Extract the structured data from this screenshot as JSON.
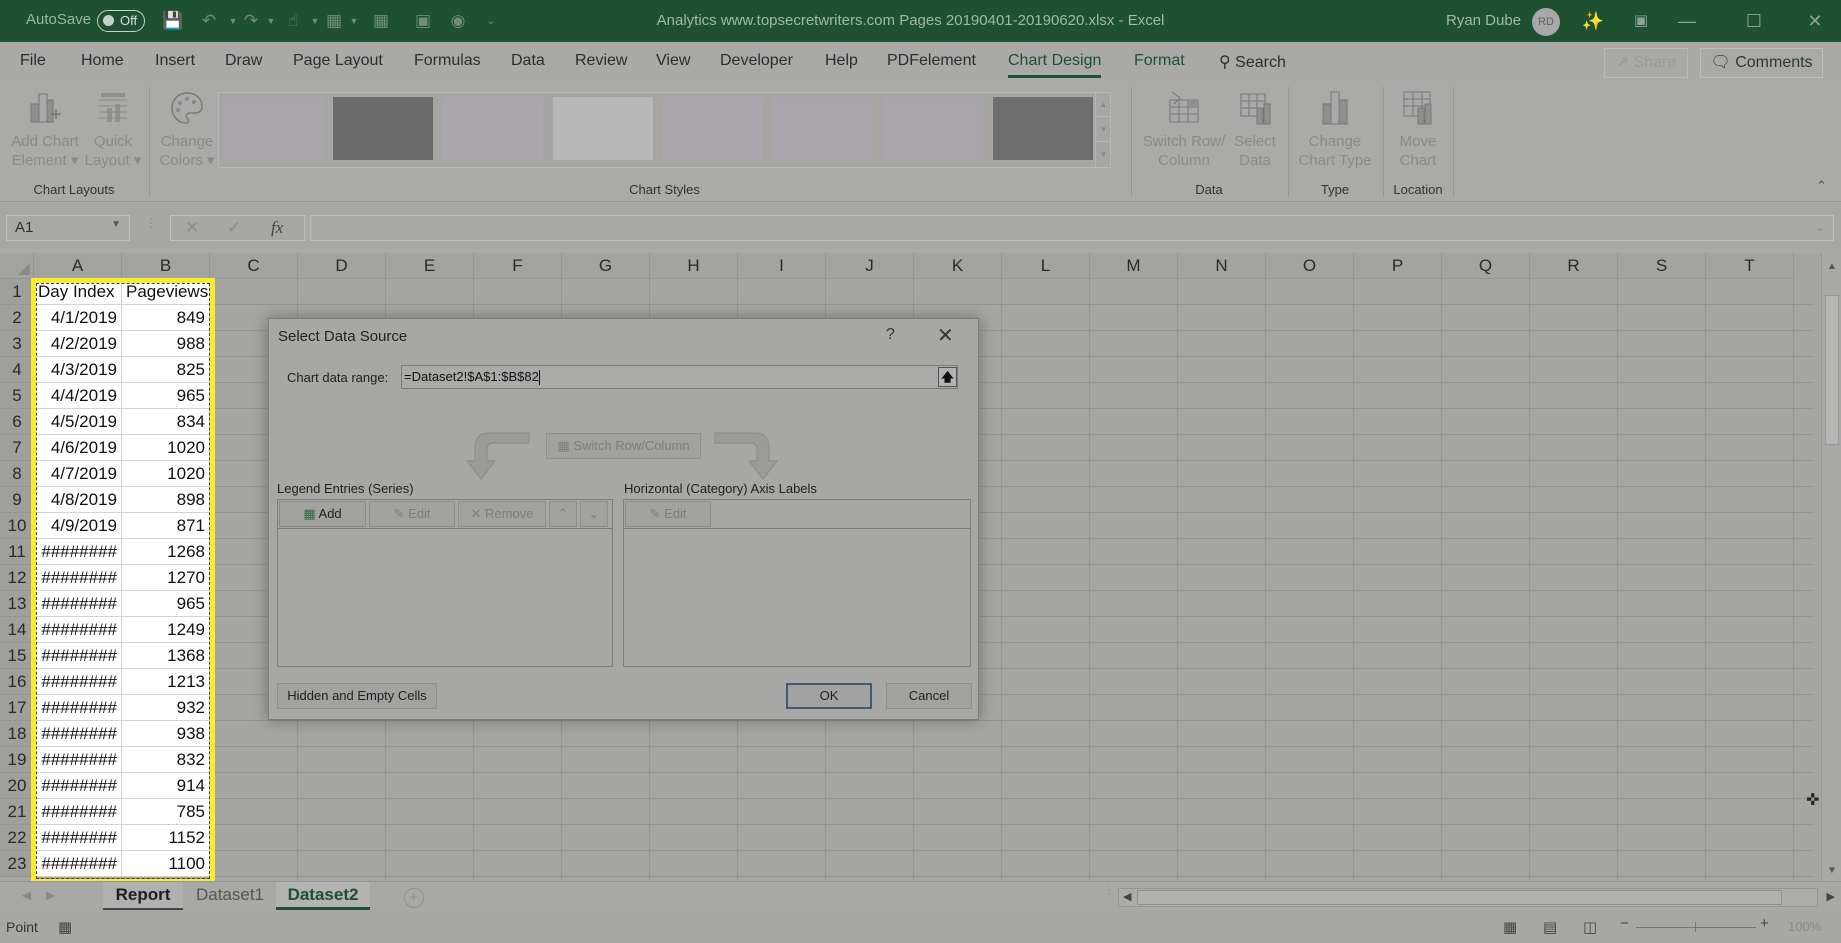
{
  "titlebar": {
    "autosave_label": "AutoSave",
    "autosave_state": "Off",
    "document_title": "Analytics www.topsecretwriters.com Pages 20190401-20190620.xlsx  -  Excel",
    "user_name": "Ryan Dube",
    "user_initials": "RD"
  },
  "ribbon_tabs": [
    "File",
    "Home",
    "Insert",
    "Draw",
    "Page Layout",
    "Formulas",
    "Data",
    "Review",
    "View",
    "Developer",
    "Help",
    "PDFelement",
    "Chart Design",
    "Format"
  ],
  "active_tab": "Chart Design",
  "search_label": "Search",
  "share_label": "Share",
  "comments_label": "Comments",
  "ribbon": {
    "add_chart_element": [
      "Add Chart",
      "Element"
    ],
    "quick_layout": [
      "Quick",
      "Layout"
    ],
    "change_colors": [
      "Change",
      "Colors"
    ],
    "group_chart_layouts": "Chart Layouts",
    "group_chart_styles": "Chart Styles",
    "switch_row_column": [
      "Switch Row/",
      "Column"
    ],
    "select_data": [
      "Select",
      "Data"
    ],
    "group_data": "Data",
    "change_chart_type": [
      "Change",
      "Chart Type"
    ],
    "group_type": "Type",
    "move_chart": [
      "Move",
      "Chart"
    ],
    "group_location": "Location",
    "style_swatch_colors": [
      "#aba6ab",
      "#6b6b6b",
      "#aba7ad",
      "#b8b8b8",
      "#aba7ad",
      "#aaa6ab",
      "#aaa6ab",
      "#6e6e6e"
    ]
  },
  "formula_bar": {
    "name_box": "A1",
    "fx_label": "fx",
    "formula": ""
  },
  "columns": [
    "A",
    "B",
    "C",
    "D",
    "E",
    "F",
    "G",
    "H",
    "I",
    "J",
    "K",
    "L",
    "M",
    "N",
    "O",
    "P",
    "Q",
    "R",
    "S",
    "T"
  ],
  "rows": [
    "1",
    "2",
    "3",
    "4",
    "5",
    "6",
    "7",
    "8",
    "9",
    "10",
    "11",
    "12",
    "13",
    "14",
    "15",
    "16",
    "17",
    "18",
    "19",
    "20",
    "21",
    "22",
    "23"
  ],
  "cells": {
    "headers": [
      "Day Index",
      "Pageviews"
    ],
    "data": [
      [
        "4/1/2019",
        "849"
      ],
      [
        "4/2/2019",
        "988"
      ],
      [
        "4/3/2019",
        "825"
      ],
      [
        "4/4/2019",
        "965"
      ],
      [
        "4/5/2019",
        "834"
      ],
      [
        "4/6/2019",
        "1020"
      ],
      [
        "4/7/2019",
        "1020"
      ],
      [
        "4/8/2019",
        "898"
      ],
      [
        "4/9/2019",
        "871"
      ],
      [
        "########",
        "1268"
      ],
      [
        "########",
        "1270"
      ],
      [
        "########",
        "965"
      ],
      [
        "########",
        "1249"
      ],
      [
        "########",
        "1368"
      ],
      [
        "########",
        "1213"
      ],
      [
        "########",
        "932"
      ],
      [
        "########",
        "938"
      ],
      [
        "########",
        "832"
      ],
      [
        "########",
        "914"
      ],
      [
        "########",
        "785"
      ],
      [
        "########",
        "1152"
      ],
      [
        "########",
        "1100"
      ]
    ]
  },
  "sheets": [
    "Report",
    "Dataset1",
    "Dataset2"
  ],
  "active_sheet": "Dataset2",
  "status": {
    "mode": "Point",
    "zoom": "100%"
  },
  "dialog": {
    "title": "Select Data Source",
    "help": "?",
    "chart_data_range_label": "Chart data range:",
    "chart_data_range_value": "=Dataset2!$A$1:$B$82",
    "switch_row_column": "Switch Row/Column",
    "legend_entries_label": "Legend Entries (Series)",
    "axis_labels_label": "Horizontal (Category) Axis Labels",
    "add": "Add",
    "edit": "Edit",
    "remove": "Remove",
    "axis_edit": "Edit",
    "hidden_empty_cells": "Hidden and Empty Cells",
    "ok": "OK",
    "cancel": "Cancel"
  }
}
